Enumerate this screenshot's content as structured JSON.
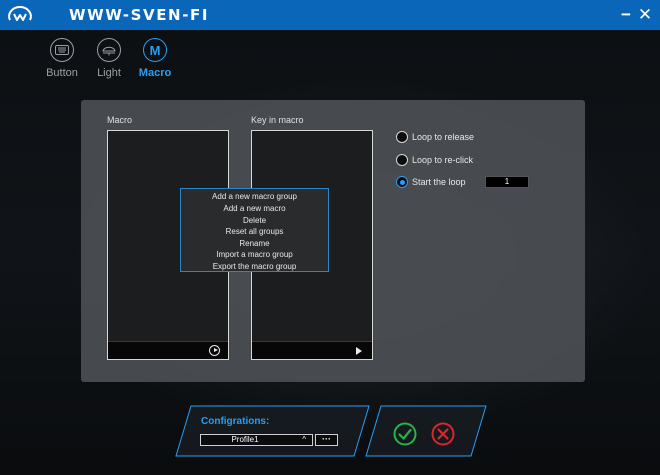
{
  "app": {
    "brand": "WWW-SVEN-FI"
  },
  "window_controls": {
    "minimize": "−",
    "close": "✕"
  },
  "tabs": [
    {
      "label": "Button",
      "icon": "keyboard-icon",
      "active": false
    },
    {
      "label": "Light",
      "icon": "light-icon",
      "active": false
    },
    {
      "label": "Macro",
      "icon_text": "M",
      "active": true
    }
  ],
  "macro_panel": {
    "macro_title": "Macro",
    "keys_title": "Key in macro"
  },
  "context_menu": [
    "Add a new macro group",
    "Add a new macro",
    "Delete",
    "Reset all groups",
    "Rename",
    "Import a macro group",
    "Export the macro group"
  ],
  "loop_options": [
    {
      "label": "Loop to release",
      "checked": false
    },
    {
      "label": "Loop to re-click",
      "checked": false
    },
    {
      "label": "Start the loop",
      "checked": true
    }
  ],
  "loop_count": "1",
  "configurations": {
    "title": "Configrations:",
    "profile": "Profile1",
    "caret": "^",
    "more": "···"
  },
  "colors": {
    "titlebar": "#0a66b8",
    "accent": "#2a9df4",
    "confirm": "#27b24a",
    "cancel": "#d9262b"
  }
}
